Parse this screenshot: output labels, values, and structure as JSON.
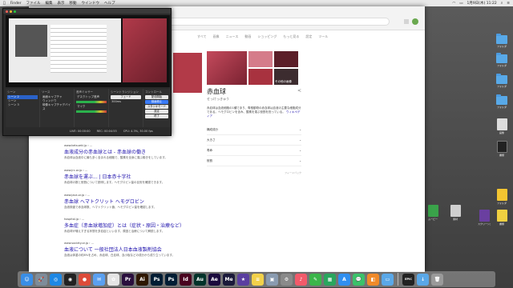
{
  "menubar": {
    "items": [
      "",
      "Finder",
      "ファイル",
      "編集",
      "表示",
      "移動",
      "ウインドウ",
      "ヘルプ"
    ],
    "right_time": "1月9日(木) 11:22"
  },
  "browser": {
    "tab_label": "赤血球",
    "gtabs": [
      "すべて",
      "画像",
      "ニュース",
      "動画",
      "ショッピング",
      "もっと見る",
      "設定",
      "ツール"
    ],
    "knowledge_panel": {
      "title": "赤血球",
      "subtitle": "せっけっきゅう",
      "more_images": "その他の画像",
      "description": "赤血球は血液細胞の1種であり、脊椎動物の赤血球は血液の主要な細胞成分である。ヘモグロビンを含み、酸素を運ぶ役割を担っている。",
      "wiki_link": "ウィキペディア",
      "rows": [
        "構成成分",
        "大きさ",
        "寿命",
        "役割"
      ],
      "feedback": "フィードバック"
    },
    "results": [
      {
        "url": "www.ketsueki.jp › ...",
        "title": "血液成分の赤血球とは - 赤血球の働き",
        "snippet": "赤血球は血液中に最も多く含まれる細胞で、酸素を全身に運ぶ働きをしています。"
      },
      {
        "url": "www.jrc.or.jp › ...",
        "title": "赤血球を運ぶ... | 日本赤十字社",
        "snippet": "赤血球の数と役割について説明します。ヘモグロビン量の目安を確認できます。"
      },
      {
        "url": "www.jaca.or.jp › ...",
        "title": "赤血球 ヘマトクリット ヘモグロビン",
        "snippet": "血液検査で赤血球数、ヘマトクリット値、ヘモグロビン量を確認します。"
      },
      {
        "url": "hospital.jp › ...",
        "title": "多血症（赤血球増加症）とは（症状・原因・治療など）",
        "snippet": "赤血球が増えすぎる状態を多血症といいます。原因と治療について解説します。"
      },
      {
        "url": "www.society.or.jp › ...",
        "title": "血液について 一般社団法人日本血液製剤協会",
        "snippet": "血液は体重の約8%を占め、赤血球、白血球、血小板などの成分から成り立っています。"
      }
    ]
  },
  "recorder": {
    "panels": {
      "scenes_head": "シーン",
      "scenes": [
        "シーン 2",
        "シーン",
        "シーン 3"
      ],
      "sources_head": "ソース",
      "sources": [
        "画面キャプチャ",
        "ウィンドウ",
        "映像キャプチャデバイス"
      ],
      "mixer_head": "音声ミキサー",
      "mixer": [
        "デスクトップ音声",
        "マイク"
      ],
      "transitions_head": "シーントランジション",
      "transition_value": "フェード",
      "duration": "300ms",
      "controls_head": "コントロール",
      "controls": [
        "配信開始",
        "録画停止",
        "スタジオモード",
        "設定",
        "終了"
      ]
    },
    "status": {
      "live": "LIVE: 00:00:00",
      "rec": "REC: 00:04:55",
      "cpu": "CPU: 4.3%, 30.00 fps"
    }
  },
  "desktop_icons": [
    {
      "label": "フォルダ"
    },
    {
      "label": "フォルダ"
    },
    {
      "label": "フォルダ"
    },
    {
      "label": "フォルダ"
    },
    {
      "label": "画像"
    },
    {
      "label": "書類"
    },
    {
      "label": "スクリーンショット"
    },
    {
      "label": "フォルダ"
    },
    {
      "label": "ムービー"
    },
    {
      "label": "素材"
    },
    {
      "label": "書類"
    }
  ],
  "dock": {
    "apps": [
      {
        "name": "Finder",
        "glyph": "☺",
        "color": "#3a8ee6"
      },
      {
        "name": "Launchpad",
        "glyph": "🚀",
        "color": "#7e8c9a"
      },
      {
        "name": "Safari",
        "glyph": "◎",
        "color": "#1e88e5"
      },
      {
        "name": "OBS",
        "glyph": "◉",
        "color": "#222222"
      },
      {
        "name": "Chrome",
        "glyph": "●",
        "color": "#dd4b39"
      },
      {
        "name": "Mail",
        "glyph": "✉",
        "color": "#5aa0f0"
      },
      {
        "name": "Photos",
        "glyph": "✿",
        "color": "#e5e5e5"
      },
      {
        "name": "Premiere",
        "glyph": "Pr",
        "color": "#2a0f3d"
      },
      {
        "name": "Illustrator",
        "glyph": "Ai",
        "color": "#2e1700"
      },
      {
        "name": "Photoshop",
        "glyph": "Ps",
        "color": "#001d34"
      },
      {
        "name": "Photoshop 2",
        "glyph": "Ps",
        "color": "#001d34"
      },
      {
        "name": "InDesign",
        "glyph": "Id",
        "color": "#49021f"
      },
      {
        "name": "Audition",
        "glyph": "Au",
        "color": "#00332a"
      },
      {
        "name": "After Effects",
        "glyph": "Ae",
        "color": "#1a0a3d"
      },
      {
        "name": "Media Encoder",
        "glyph": "Me",
        "color": "#1b1a3a"
      },
      {
        "name": "iMovie",
        "glyph": "★",
        "color": "#5b3fa0"
      },
      {
        "name": "Notes",
        "glyph": "≡",
        "color": "#f2d14a"
      },
      {
        "name": "Preview",
        "glyph": "▣",
        "color": "#8a9bb0"
      },
      {
        "name": "Settings",
        "glyph": "⚙",
        "color": "#8a8a8a"
      },
      {
        "name": "Music",
        "glyph": "♪",
        "color": "#f25a6a"
      },
      {
        "name": "Stickies",
        "glyph": "✎",
        "color": "#3bb64a"
      },
      {
        "name": "Numbers",
        "glyph": "▦",
        "color": "#2aa65e"
      },
      {
        "name": "App Store",
        "glyph": "A",
        "color": "#2f8ff0"
      },
      {
        "name": "Messages",
        "glyph": "💬",
        "color": "#3bc26a"
      },
      {
        "name": "Books",
        "glyph": "◧",
        "color": "#f08a2a"
      },
      {
        "name": "Folder",
        "glyph": "▭",
        "color": "#5aa8e8"
      },
      {
        "name": "Epic Games",
        "glyph": "EPIC",
        "color": "#222222"
      },
      {
        "name": "Downloads",
        "glyph": "↓",
        "color": "#5aa8e8"
      },
      {
        "name": "Trash",
        "glyph": "🗑",
        "color": "#9a9a9a"
      }
    ]
  }
}
